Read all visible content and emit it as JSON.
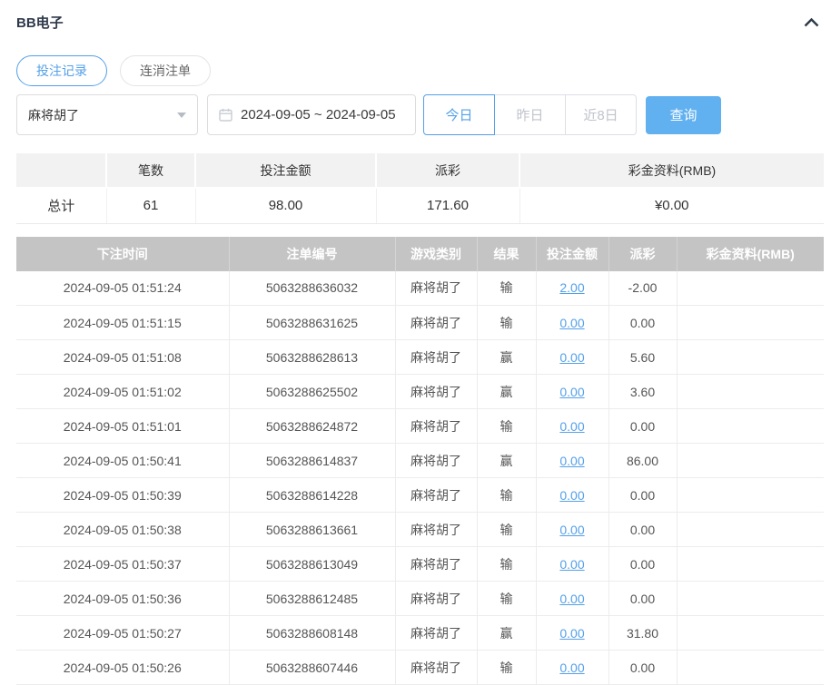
{
  "page": {
    "title": "BB电子"
  },
  "header": {
    "collapse_icon": "chevron-up"
  },
  "tabs": [
    {
      "label": "投注记录",
      "active": true
    },
    {
      "label": "连消注单",
      "active": false
    }
  ],
  "filters": {
    "game_select": {
      "value": "麻将胡了",
      "icon": "caret-down"
    },
    "date_range": {
      "value": "2024-09-05 ~ 2024-09-05",
      "icon": "calendar"
    },
    "quick_ranges": [
      {
        "label": "今日",
        "active": true
      },
      {
        "label": "昨日",
        "active": false
      },
      {
        "label": "近8日",
        "active": false
      }
    ],
    "query_button": "查询"
  },
  "summary": {
    "headers": [
      "",
      "笔数",
      "投注金额",
      "派彩",
      "彩金资料(RMB)"
    ],
    "total": {
      "label": "总计",
      "count": "61",
      "bet_amount": "98.00",
      "payout": "171.60",
      "jackpot": "¥0.00"
    }
  },
  "records": {
    "headers": [
      "下注时间",
      "注单编号",
      "游戏类别",
      "结果",
      "投注金额",
      "派彩",
      "彩金资料(RMB)"
    ],
    "rows": [
      {
        "time": "2024-09-05 01:51:24",
        "order": "5063288636032",
        "game": "麻将胡了",
        "result": "输",
        "bet": "2.00",
        "payout": "-2.00",
        "jackpot": ""
      },
      {
        "time": "2024-09-05 01:51:15",
        "order": "5063288631625",
        "game": "麻将胡了",
        "result": "输",
        "bet": "0.00",
        "payout": "0.00",
        "jackpot": ""
      },
      {
        "time": "2024-09-05 01:51:08",
        "order": "5063288628613",
        "game": "麻将胡了",
        "result": "赢",
        "bet": "0.00",
        "payout": "5.60",
        "jackpot": ""
      },
      {
        "time": "2024-09-05 01:51:02",
        "order": "5063288625502",
        "game": "麻将胡了",
        "result": "赢",
        "bet": "0.00",
        "payout": "3.60",
        "jackpot": ""
      },
      {
        "time": "2024-09-05 01:51:01",
        "order": "5063288624872",
        "game": "麻将胡了",
        "result": "输",
        "bet": "0.00",
        "payout": "0.00",
        "jackpot": ""
      },
      {
        "time": "2024-09-05 01:50:41",
        "order": "5063288614837",
        "game": "麻将胡了",
        "result": "赢",
        "bet": "0.00",
        "payout": "86.00",
        "jackpot": ""
      },
      {
        "time": "2024-09-05 01:50:39",
        "order": "5063288614228",
        "game": "麻将胡了",
        "result": "输",
        "bet": "0.00",
        "payout": "0.00",
        "jackpot": ""
      },
      {
        "time": "2024-09-05 01:50:38",
        "order": "5063288613661",
        "game": "麻将胡了",
        "result": "输",
        "bet": "0.00",
        "payout": "0.00",
        "jackpot": ""
      },
      {
        "time": "2024-09-05 01:50:37",
        "order": "5063288613049",
        "game": "麻将胡了",
        "result": "输",
        "bet": "0.00",
        "payout": "0.00",
        "jackpot": ""
      },
      {
        "time": "2024-09-05 01:50:36",
        "order": "5063288612485",
        "game": "麻将胡了",
        "result": "输",
        "bet": "0.00",
        "payout": "0.00",
        "jackpot": ""
      },
      {
        "time": "2024-09-05 01:50:27",
        "order": "5063288608148",
        "game": "麻将胡了",
        "result": "赢",
        "bet": "0.00",
        "payout": "31.80",
        "jackpot": ""
      },
      {
        "time": "2024-09-05 01:50:26",
        "order": "5063288607446",
        "game": "麻将胡了",
        "result": "输",
        "bet": "0.00",
        "payout": "0.00",
        "jackpot": ""
      }
    ]
  },
  "colors": {
    "accent": "#54a0e8",
    "query_button_bg": "#61b0f0",
    "negative": "#ee5a52",
    "records_header_bg": "#c4c4c4",
    "summary_header_bg": "#f2f2f2"
  }
}
